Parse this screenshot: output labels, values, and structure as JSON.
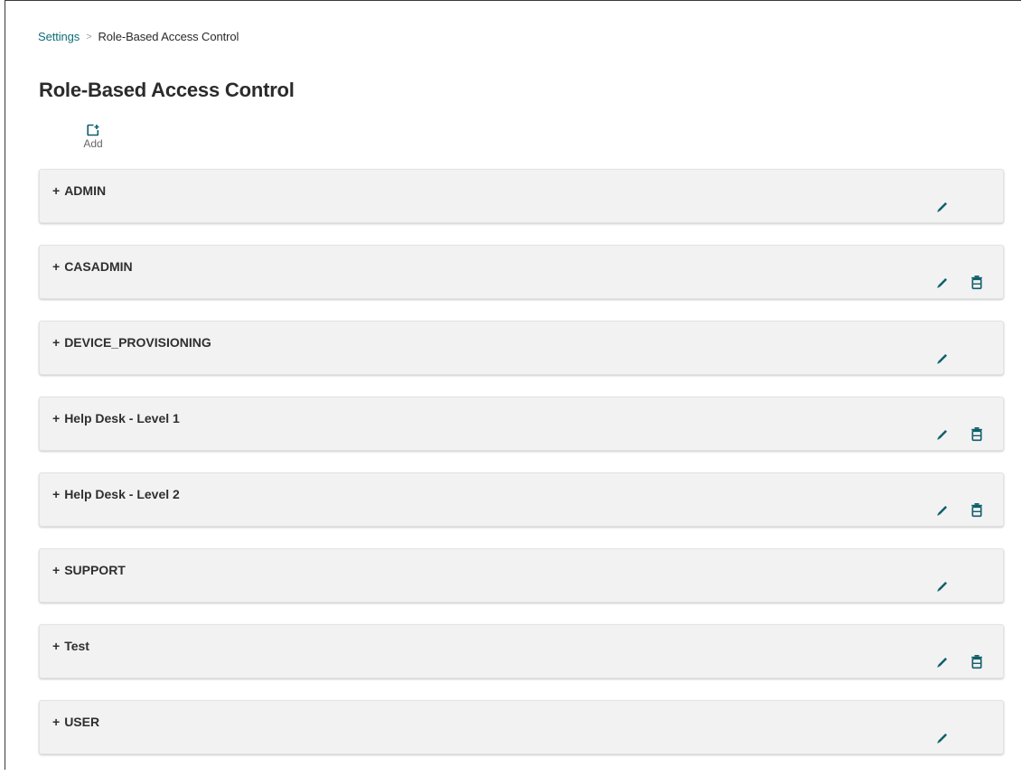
{
  "breadcrumb": {
    "items": [
      {
        "label": "Settings"
      },
      {
        "label": "Role-Based Access Control"
      }
    ],
    "separator": ">"
  },
  "page": {
    "title": "Role-Based Access Control"
  },
  "toolbar": {
    "add_label": "Add",
    "add_icon": "add-icon"
  },
  "roles": [
    {
      "toggle": "+",
      "name": "ADMIN",
      "actions": [
        "edit"
      ]
    },
    {
      "toggle": "+",
      "name": "CASADMIN",
      "actions": [
        "edit",
        "delete"
      ]
    },
    {
      "toggle": "+",
      "name": "DEVICE_PROVISIONING",
      "actions": [
        "edit"
      ]
    },
    {
      "toggle": "+",
      "name": "Help Desk - Level 1",
      "actions": [
        "edit",
        "delete"
      ]
    },
    {
      "toggle": "+",
      "name": "Help Desk - Level 2",
      "actions": [
        "edit",
        "delete"
      ]
    },
    {
      "toggle": "+",
      "name": "SUPPORT",
      "actions": [
        "edit"
      ]
    },
    {
      "toggle": "+",
      "name": "Test",
      "actions": [
        "edit",
        "delete"
      ]
    },
    {
      "toggle": "+",
      "name": "USER",
      "actions": [
        "edit"
      ]
    }
  ],
  "colors": {
    "accent": "#0f6d7a",
    "icon": "#0f5f6b",
    "card_background": "#f2f2f2"
  }
}
